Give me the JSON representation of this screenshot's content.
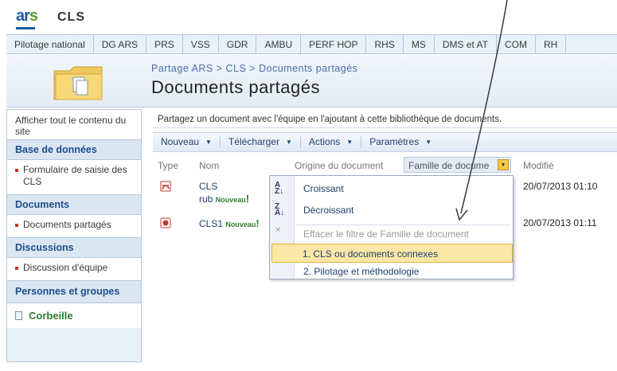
{
  "header": {
    "logo_prefix": "ar",
    "logo_suffix": "s",
    "site_title": "CLS"
  },
  "top_nav": [
    "Pilotage national",
    "DG ARS",
    "PRS",
    "VSS",
    "GDR",
    "AMBU",
    "PERF HOP",
    "RHS",
    "MS",
    "DMS et AT",
    "COM",
    "RH"
  ],
  "breadcrumb": "Partage ARS > CLS > Documents partagés",
  "page_title": "Documents partagés",
  "left_nav": {
    "view_all": "Afficher tout le contenu du site",
    "sections": [
      {
        "heading": "Base de données",
        "items": [
          "Formulaire de saisie des CLS"
        ]
      },
      {
        "heading": "Documents",
        "items": [
          "Documents partagés"
        ]
      },
      {
        "heading": "Discussions",
        "items": [
          "Discussion d'équipe"
        ]
      },
      {
        "heading": "Personnes et groupes",
        "items": []
      }
    ],
    "recycle_bin": "Corbeille"
  },
  "library": {
    "description": "Partagez un document avec l'équipe en l'ajoutant à cette bibliothèque de documents.",
    "toolbar": [
      "Nouveau",
      "Télécharger",
      "Actions",
      "Paramètres"
    ],
    "columns": {
      "type": "Type",
      "name": "Nom",
      "origin": "Origine du document",
      "family": "Famille de docume",
      "modified": "Modifié"
    },
    "rows": [
      {
        "name_line1": "CLS",
        "name_line2": "rub",
        "new_label": "Nouveau",
        "modified": "20/07/2013 01:10",
        "icon": "pdf-icon"
      },
      {
        "name_line1": "CLS1",
        "name_line2": "",
        "new_label": "Nouveau",
        "modified": "20/07/2013 01:11",
        "icon": "ppt-icon"
      }
    ]
  },
  "filter_menu": {
    "items": [
      {
        "label": "Croissant",
        "icon": "sort-ascending-icon"
      },
      {
        "label": "Décroissant",
        "icon": "sort-descending-icon"
      },
      {
        "label": "Effacer le filtre de Famille de document",
        "icon": "clear-filter-icon"
      }
    ],
    "options": [
      "1. CLS ou documents connexes",
      "2. Pilotage et méthodologie"
    ],
    "selected_index": 0
  },
  "colors": {
    "accent_blue": "#1c5aa6",
    "nav_bg": "#e8f0f9",
    "highlight": "#fbe7a6",
    "new_green": "#2e7d32"
  }
}
